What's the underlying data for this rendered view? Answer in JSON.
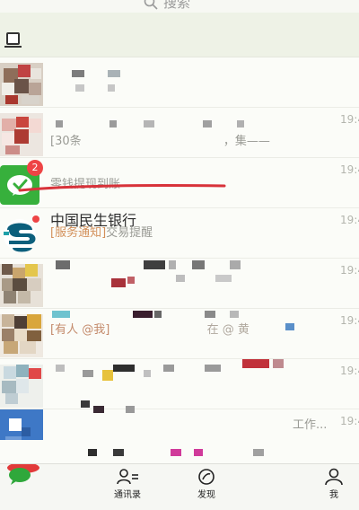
{
  "search": {
    "placeholder": "搜索"
  },
  "chats": [
    {
      "time": ""
    },
    {
      "time": "19:4",
      "preview": "[30条",
      "preview_tail": "，集——"
    },
    {
      "name": "",
      "preview": "零钱提现到账",
      "time": "19:4",
      "badge": "2"
    },
    {
      "name": "中国民生银行",
      "preview_tag": "[服务通知]",
      "preview": "交易提醒",
      "time": "19:4"
    },
    {
      "time": "19:4"
    },
    {
      "time": "19:4",
      "preview": "[有人 @我]",
      "preview_tail": "在 @ 黄"
    },
    {
      "time": "19:4"
    },
    {
      "time": "19:4",
      "preview_tail": "工作..."
    },
    {
      "time": ""
    }
  ],
  "tabs": {
    "chats": "",
    "contacts": "通讯录",
    "discover": "发现",
    "me": "我"
  },
  "colors": {
    "wechat_green": "#37b03c",
    "badge_red": "#ee4445",
    "annotation_red": "#d8323a"
  }
}
